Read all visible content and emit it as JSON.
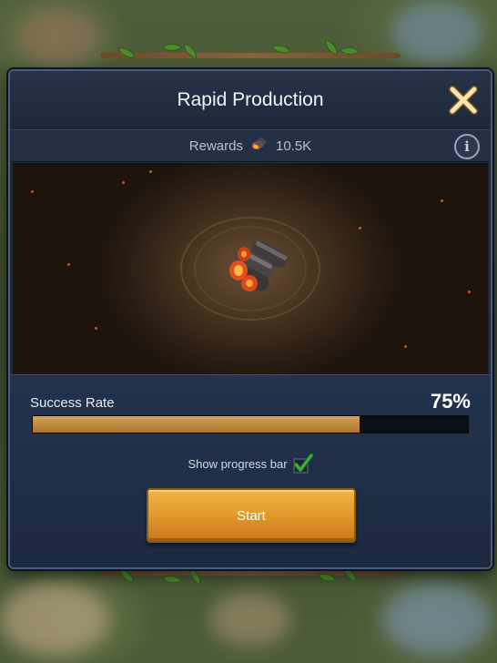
{
  "modal": {
    "title": "Rapid Production",
    "close_icon": "close-x-icon"
  },
  "rewards": {
    "label": "Rewards",
    "icon": "coal-icon",
    "amount": "10.5K",
    "info_icon": "info-icon"
  },
  "art": {
    "image": "coal-lumps-illustration"
  },
  "success": {
    "label": "Success Rate",
    "value": "75%",
    "fraction": 0.75
  },
  "show_progress": {
    "label": "Show progress bar",
    "checked": true,
    "icon": "checkmark-icon"
  },
  "start_button": {
    "label": "Start"
  },
  "colors": {
    "accent_gold": "#e39b2e",
    "progress_fill": "#c08940",
    "check_green": "#3fae3a"
  }
}
